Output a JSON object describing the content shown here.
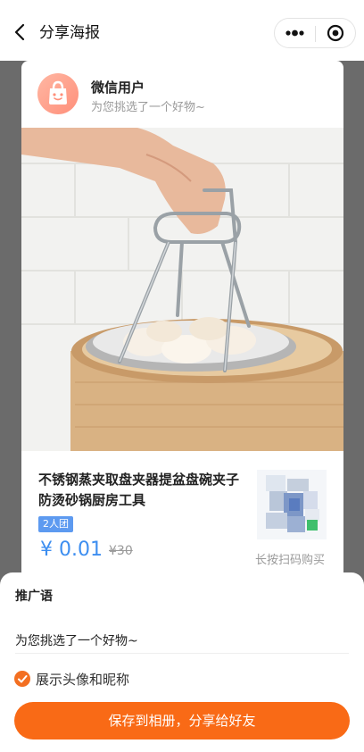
{
  "nav": {
    "title": "分享海报",
    "more_icon": "more-dots-icon",
    "close_icon": "mini-program-close-icon"
  },
  "poster": {
    "user": {
      "name": "微信用户",
      "slogan": "为您挑选了一个好物~",
      "avatar_icon": "shopping-bag-face-icon"
    },
    "product": {
      "image": "steamer-dish-clip-photo",
      "title": "不锈钢蒸夹取盘夹器提盆盘碗夹子防烫砂锅厨房工具",
      "badge": "2人团",
      "price": "¥ 0.01",
      "original_price": "¥30"
    },
    "qr": {
      "hint": "长按扫码购买"
    }
  },
  "sheet": {
    "section_label": "推广语",
    "promo_text": "为您挑选了一个好物~",
    "show_avatar_label": "展示头像和昵称",
    "show_avatar_checked": true,
    "save_button": "保存到相册，分享给好友"
  },
  "colors": {
    "accent": "#f96a16",
    "price": "#3d8ef0",
    "badge": "#5d9af0"
  }
}
